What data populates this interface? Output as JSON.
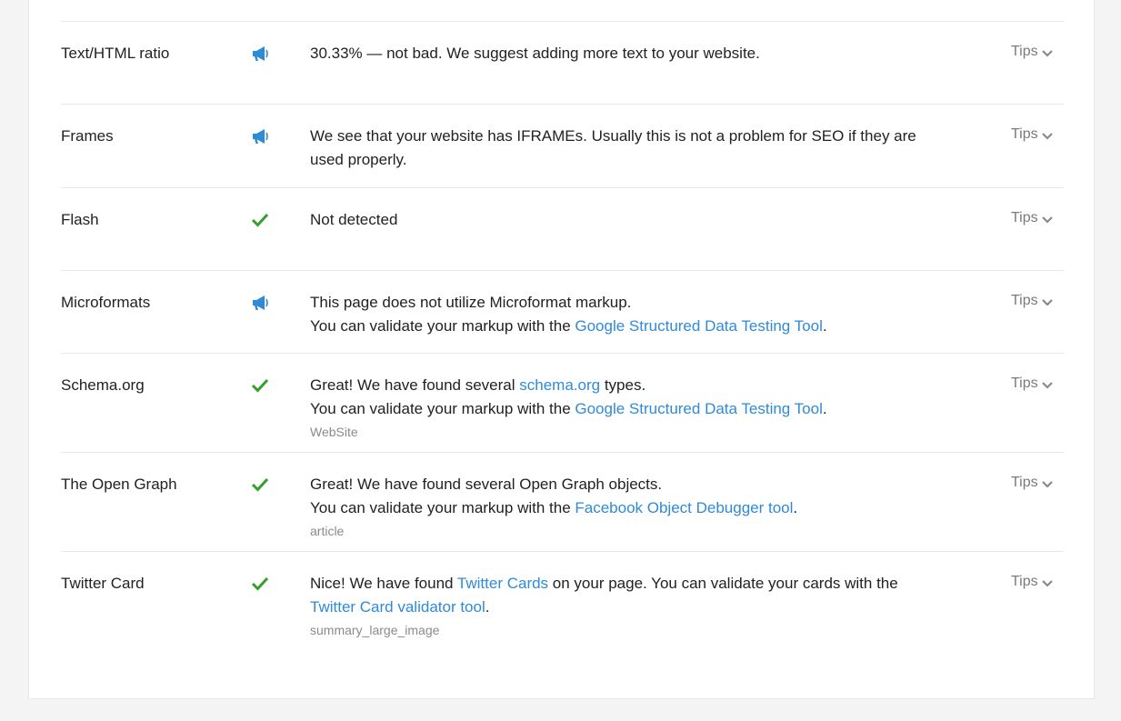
{
  "colors": {
    "accent": "#2f8ad8",
    "success": "#33a02c",
    "info": "#2f8ad8"
  },
  "rows": [
    {
      "label": "Text/HTML ratio",
      "status_icon": "megaphone-icon",
      "line1": "30.33% — not bad. We suggest adding more text to your website.",
      "tips": "Tips"
    },
    {
      "label": "Frames",
      "status_icon": "megaphone-icon",
      "line1": "We see that your website has IFRAMEs. Usually this is not a problem for SEO if they are",
      "line2": "used properly.",
      "tips": "Tips"
    },
    {
      "label": "Flash",
      "status_icon": "check-icon",
      "line1": "Not detected",
      "tips": "Tips"
    },
    {
      "label": "Microformats",
      "status_icon": "megaphone-icon",
      "line1": "This page does not utilize Microformat markup.",
      "line2_pre": "You can validate your markup with the ",
      "line2_link": "Google Structured Data Testing Tool",
      "line2_post": ".",
      "tips": "Tips"
    },
    {
      "label": "Schema.org",
      "status_icon": "check-icon",
      "line1_pre": "Great! We have found several ",
      "line1_link": "schema.org",
      "line1_post": " types.",
      "line2_pre": "You can validate your markup with the ",
      "line2_link": "Google Structured Data Testing Tool",
      "line2_post": ".",
      "sub": "WebSite",
      "tips": "Tips"
    },
    {
      "label": "The Open Graph",
      "status_icon": "check-icon",
      "line1": "Great! We have found several Open Graph objects.",
      "line2_pre": "You can validate your markup with the ",
      "line2_link": "Facebook Object Debugger tool",
      "line2_post": ".",
      "sub": "article",
      "tips": "Tips"
    },
    {
      "label": "Twitter Card",
      "status_icon": "check-icon",
      "line1_pre": "Nice! We have found ",
      "line1_link": "Twitter Cards",
      "line1_post": " on your page. You can validate your cards with the",
      "line2_link": "Twitter Card validator tool",
      "line2_post": ".",
      "sub": "summary_large_image",
      "tips": "Tips"
    }
  ]
}
